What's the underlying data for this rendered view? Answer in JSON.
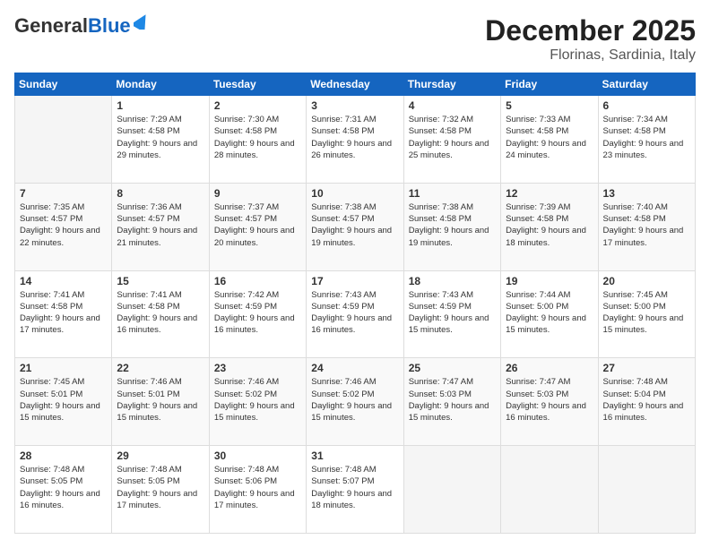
{
  "header": {
    "logo_general": "General",
    "logo_blue": "Blue",
    "month_year": "December 2025",
    "location": "Florinas, Sardinia, Italy"
  },
  "days_of_week": [
    "Sunday",
    "Monday",
    "Tuesday",
    "Wednesday",
    "Thursday",
    "Friday",
    "Saturday"
  ],
  "weeks": [
    [
      {
        "day": "",
        "sunrise": "",
        "sunset": "",
        "daylight": ""
      },
      {
        "day": "1",
        "sunrise": "Sunrise: 7:29 AM",
        "sunset": "Sunset: 4:58 PM",
        "daylight": "Daylight: 9 hours and 29 minutes."
      },
      {
        "day": "2",
        "sunrise": "Sunrise: 7:30 AM",
        "sunset": "Sunset: 4:58 PM",
        "daylight": "Daylight: 9 hours and 28 minutes."
      },
      {
        "day": "3",
        "sunrise": "Sunrise: 7:31 AM",
        "sunset": "Sunset: 4:58 PM",
        "daylight": "Daylight: 9 hours and 26 minutes."
      },
      {
        "day": "4",
        "sunrise": "Sunrise: 7:32 AM",
        "sunset": "Sunset: 4:58 PM",
        "daylight": "Daylight: 9 hours and 25 minutes."
      },
      {
        "day": "5",
        "sunrise": "Sunrise: 7:33 AM",
        "sunset": "Sunset: 4:58 PM",
        "daylight": "Daylight: 9 hours and 24 minutes."
      },
      {
        "day": "6",
        "sunrise": "Sunrise: 7:34 AM",
        "sunset": "Sunset: 4:58 PM",
        "daylight": "Daylight: 9 hours and 23 minutes."
      }
    ],
    [
      {
        "day": "7",
        "sunrise": "Sunrise: 7:35 AM",
        "sunset": "Sunset: 4:57 PM",
        "daylight": "Daylight: 9 hours and 22 minutes."
      },
      {
        "day": "8",
        "sunrise": "Sunrise: 7:36 AM",
        "sunset": "Sunset: 4:57 PM",
        "daylight": "Daylight: 9 hours and 21 minutes."
      },
      {
        "day": "9",
        "sunrise": "Sunrise: 7:37 AM",
        "sunset": "Sunset: 4:57 PM",
        "daylight": "Daylight: 9 hours and 20 minutes."
      },
      {
        "day": "10",
        "sunrise": "Sunrise: 7:38 AM",
        "sunset": "Sunset: 4:57 PM",
        "daylight": "Daylight: 9 hours and 19 minutes."
      },
      {
        "day": "11",
        "sunrise": "Sunrise: 7:38 AM",
        "sunset": "Sunset: 4:58 PM",
        "daylight": "Daylight: 9 hours and 19 minutes."
      },
      {
        "day": "12",
        "sunrise": "Sunrise: 7:39 AM",
        "sunset": "Sunset: 4:58 PM",
        "daylight": "Daylight: 9 hours and 18 minutes."
      },
      {
        "day": "13",
        "sunrise": "Sunrise: 7:40 AM",
        "sunset": "Sunset: 4:58 PM",
        "daylight": "Daylight: 9 hours and 17 minutes."
      }
    ],
    [
      {
        "day": "14",
        "sunrise": "Sunrise: 7:41 AM",
        "sunset": "Sunset: 4:58 PM",
        "daylight": "Daylight: 9 hours and 17 minutes."
      },
      {
        "day": "15",
        "sunrise": "Sunrise: 7:41 AM",
        "sunset": "Sunset: 4:58 PM",
        "daylight": "Daylight: 9 hours and 16 minutes."
      },
      {
        "day": "16",
        "sunrise": "Sunrise: 7:42 AM",
        "sunset": "Sunset: 4:59 PM",
        "daylight": "Daylight: 9 hours and 16 minutes."
      },
      {
        "day": "17",
        "sunrise": "Sunrise: 7:43 AM",
        "sunset": "Sunset: 4:59 PM",
        "daylight": "Daylight: 9 hours and 16 minutes."
      },
      {
        "day": "18",
        "sunrise": "Sunrise: 7:43 AM",
        "sunset": "Sunset: 4:59 PM",
        "daylight": "Daylight: 9 hours and 15 minutes."
      },
      {
        "day": "19",
        "sunrise": "Sunrise: 7:44 AM",
        "sunset": "Sunset: 5:00 PM",
        "daylight": "Daylight: 9 hours and 15 minutes."
      },
      {
        "day": "20",
        "sunrise": "Sunrise: 7:45 AM",
        "sunset": "Sunset: 5:00 PM",
        "daylight": "Daylight: 9 hours and 15 minutes."
      }
    ],
    [
      {
        "day": "21",
        "sunrise": "Sunrise: 7:45 AM",
        "sunset": "Sunset: 5:01 PM",
        "daylight": "Daylight: 9 hours and 15 minutes."
      },
      {
        "day": "22",
        "sunrise": "Sunrise: 7:46 AM",
        "sunset": "Sunset: 5:01 PM",
        "daylight": "Daylight: 9 hours and 15 minutes."
      },
      {
        "day": "23",
        "sunrise": "Sunrise: 7:46 AM",
        "sunset": "Sunset: 5:02 PM",
        "daylight": "Daylight: 9 hours and 15 minutes."
      },
      {
        "day": "24",
        "sunrise": "Sunrise: 7:46 AM",
        "sunset": "Sunset: 5:02 PM",
        "daylight": "Daylight: 9 hours and 15 minutes."
      },
      {
        "day": "25",
        "sunrise": "Sunrise: 7:47 AM",
        "sunset": "Sunset: 5:03 PM",
        "daylight": "Daylight: 9 hours and 15 minutes."
      },
      {
        "day": "26",
        "sunrise": "Sunrise: 7:47 AM",
        "sunset": "Sunset: 5:03 PM",
        "daylight": "Daylight: 9 hours and 16 minutes."
      },
      {
        "day": "27",
        "sunrise": "Sunrise: 7:48 AM",
        "sunset": "Sunset: 5:04 PM",
        "daylight": "Daylight: 9 hours and 16 minutes."
      }
    ],
    [
      {
        "day": "28",
        "sunrise": "Sunrise: 7:48 AM",
        "sunset": "Sunset: 5:05 PM",
        "daylight": "Daylight: 9 hours and 16 minutes."
      },
      {
        "day": "29",
        "sunrise": "Sunrise: 7:48 AM",
        "sunset": "Sunset: 5:05 PM",
        "daylight": "Daylight: 9 hours and 17 minutes."
      },
      {
        "day": "30",
        "sunrise": "Sunrise: 7:48 AM",
        "sunset": "Sunset: 5:06 PM",
        "daylight": "Daylight: 9 hours and 17 minutes."
      },
      {
        "day": "31",
        "sunrise": "Sunrise: 7:48 AM",
        "sunset": "Sunset: 5:07 PM",
        "daylight": "Daylight: 9 hours and 18 minutes."
      },
      {
        "day": "",
        "sunrise": "",
        "sunset": "",
        "daylight": ""
      },
      {
        "day": "",
        "sunrise": "",
        "sunset": "",
        "daylight": ""
      },
      {
        "day": "",
        "sunrise": "",
        "sunset": "",
        "daylight": ""
      }
    ]
  ]
}
